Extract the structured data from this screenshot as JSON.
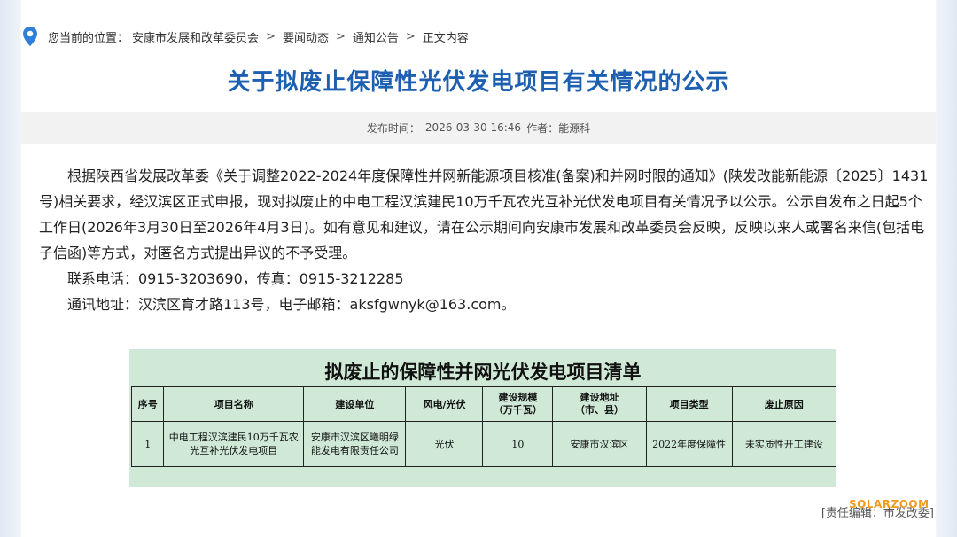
{
  "breadcrumb": {
    "prefix": "您当前的位置：",
    "items": [
      "安康市发展和改革委员会",
      "要闻动态",
      "通知公告",
      "正文内容"
    ],
    "separator": ">"
  },
  "title": "关于拟废止保障性光伏发电项目有关情况的公示",
  "meta": {
    "publish_label": "发布时间：",
    "publish_time": "2026-03-30 16:46",
    "author_label": "作者：",
    "author": "能源科"
  },
  "body": {
    "paragraph1": "根据陕西省发展改革委《关于调整2022-2024年度保障性并网新能源项目核准(备案)和并网时限的通知》(陕发改能新能源〔2025〕1431号)相关要求，经汉滨区正式申报，现对拟废止的中电工程汉滨建民10万千瓦农光互补光伏发电项目有关情况予以公示。公示自发布之日起5个工作日(2026年3月30日至2026年4月3日)。如有意见和建议，请在公示期间向安康市发展和改革委员会反映，反映以来人或署名来信(包括电子信函)等方式，对匿名方式提出异议的不予受理。",
    "phone": "联系电话：0915-3203690，传真：0915-3212285",
    "address": "通讯地址：汉滨区育才路113号，电子邮箱：aksfgwnyk@163.com。"
  },
  "table": {
    "title": "拟废止的保障性并网光伏发电项目清单",
    "headers": [
      "序号",
      "项目名称",
      "建设单位",
      "风电/光伏",
      "建设规模\n（万千瓦）",
      "建设地址\n（市、县）",
      "项目类型",
      "废止原因"
    ],
    "rows": [
      [
        "1",
        "中电工程汉滨建民10万千瓦农光互补光伏发电项目",
        "安康市汉滨区曦明绿能发电有限责任公司",
        "光伏",
        "10",
        "安康市汉滨区",
        "2022年度保障性",
        "未实质性开工建设"
      ]
    ]
  },
  "editor": "[责任编辑：市发改委]",
  "watermark": "SOLARZOOM",
  "colors": {
    "title": "#1d5fb0",
    "table_bg": "#cfe9d6",
    "pin": "#2f7fd8",
    "watermark": "#f29a1f"
  }
}
